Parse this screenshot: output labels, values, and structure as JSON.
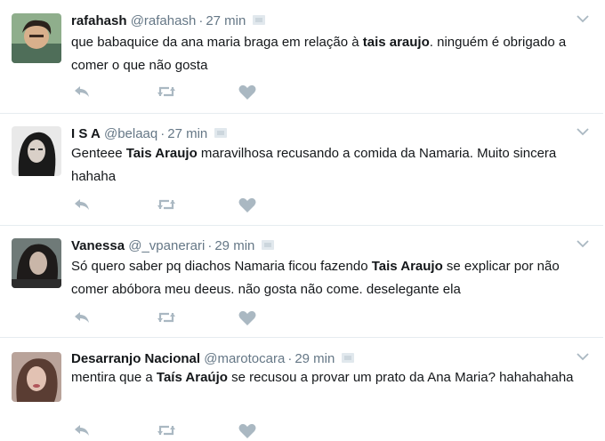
{
  "tweets": [
    {
      "name": "rafahash",
      "handle": "@rafahash",
      "time": "27 min",
      "segments": [
        {
          "text": "que babaquice da ana maria braga em relação à ",
          "bold": false
        },
        {
          "text": "tais araujo",
          "bold": true
        },
        {
          "text": ". ninguém é obrigado a comer o que não gosta",
          "bold": false
        }
      ]
    },
    {
      "name": "I S A",
      "handle": "@belaaq",
      "time": "27 min",
      "segments": [
        {
          "text": "Genteee ",
          "bold": false
        },
        {
          "text": "Tais Araujo",
          "bold": true
        },
        {
          "text": " maravilhosa recusando a comida da Namaria. Muito sincera hahaha",
          "bold": false
        }
      ]
    },
    {
      "name": "Vanessa",
      "handle": "@_vpanerari",
      "time": "29 min",
      "segments": [
        {
          "text": "Só quero saber pq diachos Namaria ficou fazendo ",
          "bold": false
        },
        {
          "text": "Tais Araujo",
          "bold": true
        },
        {
          "text": " se explicar por não comer abóbora meu deeus. não gosta não come. deselegante ela",
          "bold": false
        }
      ]
    },
    {
      "name": "Desarranjo Nacional",
      "handle": "@marotocara",
      "time": "29 min",
      "segments": [
        {
          "text": "mentira que a ",
          "bold": false
        },
        {
          "text": "Taís Araújo",
          "bold": true
        },
        {
          "text": " se recusou a provar um prato da Ana Maria? hahahahaha",
          "bold": false
        }
      ]
    }
  ],
  "separator": "·",
  "icons": {
    "reply": "reply-icon",
    "retweet": "retweet-icon",
    "like": "heart-icon",
    "menu": "chevron-down-icon",
    "media": "media-badge-icon"
  },
  "colors": {
    "icon_gray": "#aab8c2",
    "meta_gray": "#657786",
    "text": "#14171a",
    "border": "#e6ecf0"
  }
}
